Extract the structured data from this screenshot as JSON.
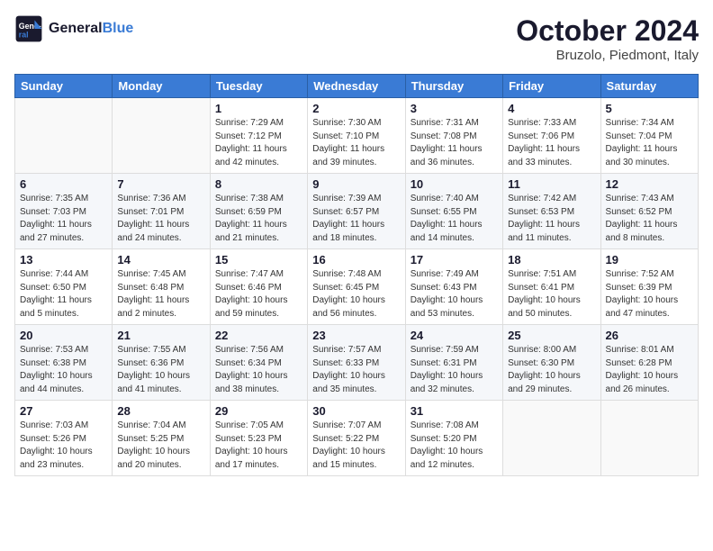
{
  "header": {
    "logo_line1": "General",
    "logo_line2": "Blue",
    "month": "October 2024",
    "location": "Bruzolo, Piedmont, Italy"
  },
  "weekdays": [
    "Sunday",
    "Monday",
    "Tuesday",
    "Wednesday",
    "Thursday",
    "Friday",
    "Saturday"
  ],
  "weeks": [
    [
      {
        "day": "",
        "text": ""
      },
      {
        "day": "",
        "text": ""
      },
      {
        "day": "1",
        "text": "Sunrise: 7:29 AM\nSunset: 7:12 PM\nDaylight: 11 hours\nand 42 minutes."
      },
      {
        "day": "2",
        "text": "Sunrise: 7:30 AM\nSunset: 7:10 PM\nDaylight: 11 hours\nand 39 minutes."
      },
      {
        "day": "3",
        "text": "Sunrise: 7:31 AM\nSunset: 7:08 PM\nDaylight: 11 hours\nand 36 minutes."
      },
      {
        "day": "4",
        "text": "Sunrise: 7:33 AM\nSunset: 7:06 PM\nDaylight: 11 hours\nand 33 minutes."
      },
      {
        "day": "5",
        "text": "Sunrise: 7:34 AM\nSunset: 7:04 PM\nDaylight: 11 hours\nand 30 minutes."
      }
    ],
    [
      {
        "day": "6",
        "text": "Sunrise: 7:35 AM\nSunset: 7:03 PM\nDaylight: 11 hours\nand 27 minutes."
      },
      {
        "day": "7",
        "text": "Sunrise: 7:36 AM\nSunset: 7:01 PM\nDaylight: 11 hours\nand 24 minutes."
      },
      {
        "day": "8",
        "text": "Sunrise: 7:38 AM\nSunset: 6:59 PM\nDaylight: 11 hours\nand 21 minutes."
      },
      {
        "day": "9",
        "text": "Sunrise: 7:39 AM\nSunset: 6:57 PM\nDaylight: 11 hours\nand 18 minutes."
      },
      {
        "day": "10",
        "text": "Sunrise: 7:40 AM\nSunset: 6:55 PM\nDaylight: 11 hours\nand 14 minutes."
      },
      {
        "day": "11",
        "text": "Sunrise: 7:42 AM\nSunset: 6:53 PM\nDaylight: 11 hours\nand 11 minutes."
      },
      {
        "day": "12",
        "text": "Sunrise: 7:43 AM\nSunset: 6:52 PM\nDaylight: 11 hours\nand 8 minutes."
      }
    ],
    [
      {
        "day": "13",
        "text": "Sunrise: 7:44 AM\nSunset: 6:50 PM\nDaylight: 11 hours\nand 5 minutes."
      },
      {
        "day": "14",
        "text": "Sunrise: 7:45 AM\nSunset: 6:48 PM\nDaylight: 11 hours\nand 2 minutes."
      },
      {
        "day": "15",
        "text": "Sunrise: 7:47 AM\nSunset: 6:46 PM\nDaylight: 10 hours\nand 59 minutes."
      },
      {
        "day": "16",
        "text": "Sunrise: 7:48 AM\nSunset: 6:45 PM\nDaylight: 10 hours\nand 56 minutes."
      },
      {
        "day": "17",
        "text": "Sunrise: 7:49 AM\nSunset: 6:43 PM\nDaylight: 10 hours\nand 53 minutes."
      },
      {
        "day": "18",
        "text": "Sunrise: 7:51 AM\nSunset: 6:41 PM\nDaylight: 10 hours\nand 50 minutes."
      },
      {
        "day": "19",
        "text": "Sunrise: 7:52 AM\nSunset: 6:39 PM\nDaylight: 10 hours\nand 47 minutes."
      }
    ],
    [
      {
        "day": "20",
        "text": "Sunrise: 7:53 AM\nSunset: 6:38 PM\nDaylight: 10 hours\nand 44 minutes."
      },
      {
        "day": "21",
        "text": "Sunrise: 7:55 AM\nSunset: 6:36 PM\nDaylight: 10 hours\nand 41 minutes."
      },
      {
        "day": "22",
        "text": "Sunrise: 7:56 AM\nSunset: 6:34 PM\nDaylight: 10 hours\nand 38 minutes."
      },
      {
        "day": "23",
        "text": "Sunrise: 7:57 AM\nSunset: 6:33 PM\nDaylight: 10 hours\nand 35 minutes."
      },
      {
        "day": "24",
        "text": "Sunrise: 7:59 AM\nSunset: 6:31 PM\nDaylight: 10 hours\nand 32 minutes."
      },
      {
        "day": "25",
        "text": "Sunrise: 8:00 AM\nSunset: 6:30 PM\nDaylight: 10 hours\nand 29 minutes."
      },
      {
        "day": "26",
        "text": "Sunrise: 8:01 AM\nSunset: 6:28 PM\nDaylight: 10 hours\nand 26 minutes."
      }
    ],
    [
      {
        "day": "27",
        "text": "Sunrise: 7:03 AM\nSunset: 5:26 PM\nDaylight: 10 hours\nand 23 minutes."
      },
      {
        "day": "28",
        "text": "Sunrise: 7:04 AM\nSunset: 5:25 PM\nDaylight: 10 hours\nand 20 minutes."
      },
      {
        "day": "29",
        "text": "Sunrise: 7:05 AM\nSunset: 5:23 PM\nDaylight: 10 hours\nand 17 minutes."
      },
      {
        "day": "30",
        "text": "Sunrise: 7:07 AM\nSunset: 5:22 PM\nDaylight: 10 hours\nand 15 minutes."
      },
      {
        "day": "31",
        "text": "Sunrise: 7:08 AM\nSunset: 5:20 PM\nDaylight: 10 hours\nand 12 minutes."
      },
      {
        "day": "",
        "text": ""
      },
      {
        "day": "",
        "text": ""
      }
    ]
  ]
}
